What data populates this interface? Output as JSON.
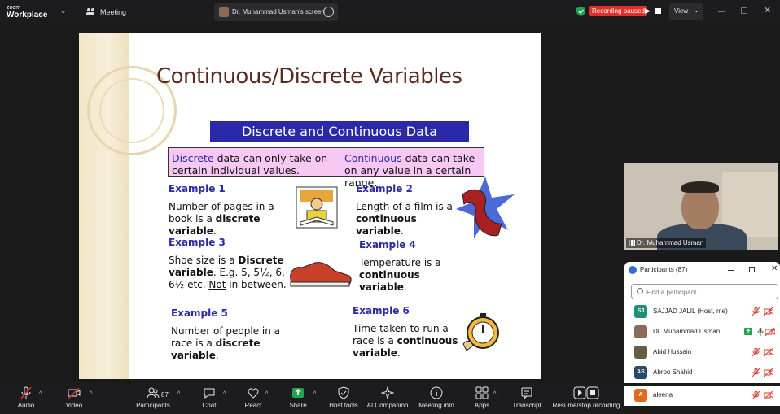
{
  "app": {
    "logo_line1": "zoom",
    "logo_line2": "Workplace",
    "meeting_label": "Meeting"
  },
  "share": {
    "label": "Dr. Muhammad Usman's screen"
  },
  "recording": {
    "status": "Recording paused"
  },
  "view": {
    "label": "View"
  },
  "slide": {
    "title": "Continuous/Discrete Variables",
    "banner": "Discrete and Continuous Data",
    "discrete_kw": "Discrete",
    "discrete_text": " data can only take on certain individual values.",
    "continuous_kw": "Continuous",
    "continuous_text": " data can take on any value in a certain range.",
    "examples": [
      {
        "head": "Example 1",
        "pre": "Number of pages in a book is a ",
        "bold": "discrete variable",
        "post": "."
      },
      {
        "head": "Example 2",
        "pre": "Length of a film is a ",
        "bold": "continuous variable",
        "post": "."
      },
      {
        "head": "Example 3",
        "pre": "Shoe size is a ",
        "bold": "Discrete variable",
        "post": ".  E.g. 5, 5½, 6, 6½ etc. ",
        "ul": "Not",
        "post2": " in between."
      },
      {
        "head": "Example 4",
        "pre": "Temperature is a ",
        "bold": "continuous variable",
        "post": "."
      },
      {
        "head": "Example 5",
        "pre": "Number of people in a race is a ",
        "bold": "discrete variable",
        "post": "."
      },
      {
        "head": "Example 6",
        "pre": "Time taken to run a race is a ",
        "bold": "continuous variable",
        "post": "."
      }
    ]
  },
  "video": {
    "name": "Dr. Muhammad Usman"
  },
  "participants": {
    "title": "Participants (87)",
    "search_placeholder": "Find a participant",
    "rows": [
      {
        "initials": "SJ",
        "name": "SAJJAD JALIL  (Host, me)",
        "color": "#1f8f7a"
      },
      {
        "initials": "",
        "name": "Dr. Muhammad Usman",
        "color": "#8a6b55"
      },
      {
        "initials": "",
        "name": "Abid Hussain",
        "color": "#6b5a48"
      },
      {
        "initials": "AS",
        "name": "Abroo Shahid",
        "color": "#2b4a6b"
      },
      {
        "initials": "A",
        "name": "aleena",
        "color": "#e26a1f"
      }
    ]
  },
  "toolbar": {
    "audio": "Audio",
    "video": "Video",
    "participants": "Participants",
    "participants_count": "87",
    "chat": "Chat",
    "react": "React",
    "share": "Share",
    "host_tools": "Host tools",
    "ai_companion": "AI Companion",
    "meeting_info": "Meeting info",
    "apps": "Apps",
    "transcript": "Transcript",
    "resume_stop": "Resume/stop recording"
  },
  "colors": {
    "recording_red": "#e0302c",
    "share_green": "#22a455",
    "banner_blue": "#2a2aa8",
    "def_pink": "#f7c8f3",
    "title_brown": "#5a2a1e"
  }
}
